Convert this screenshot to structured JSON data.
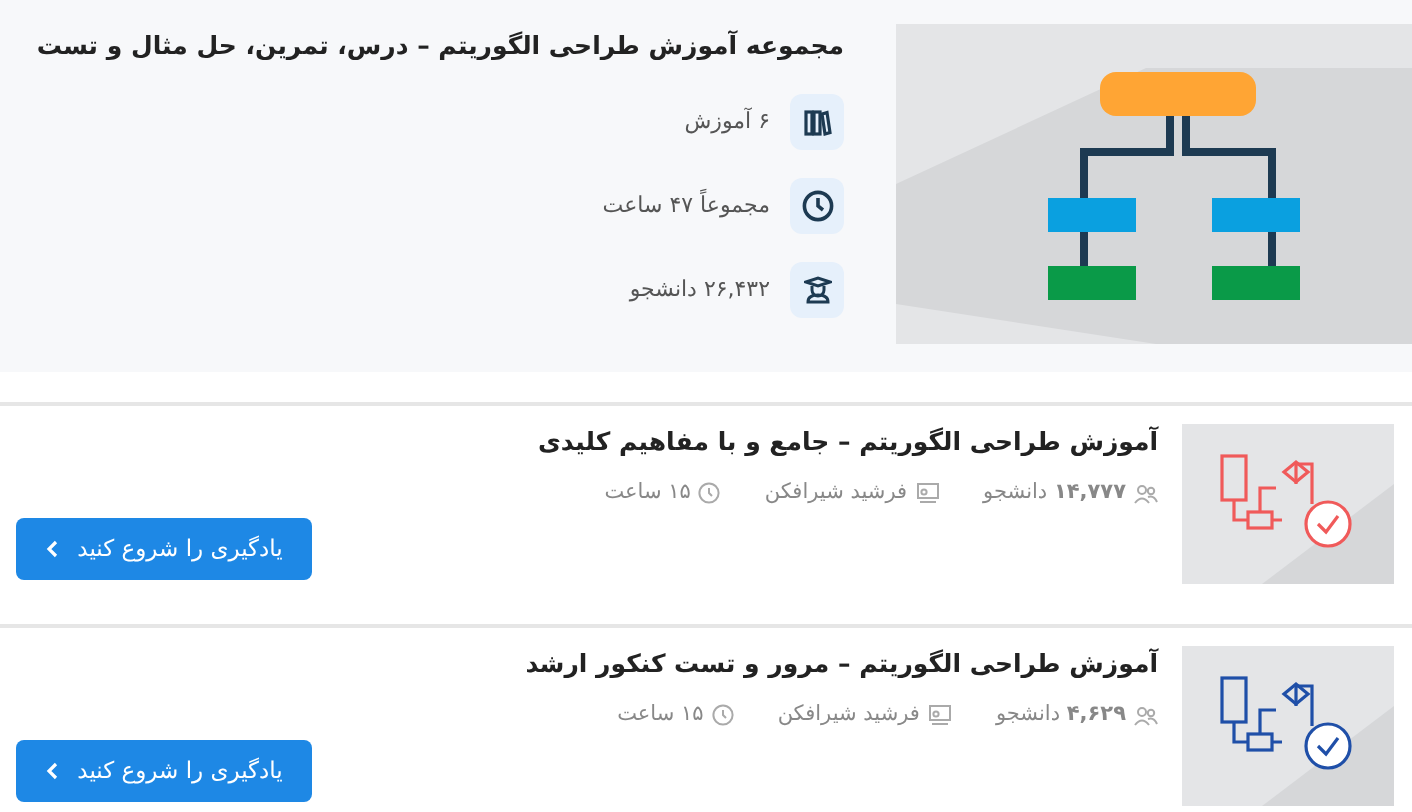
{
  "collection": {
    "title": "مجموعه آموزش طراحی الگوریتم – درس، تمرین، حل مثال و تست",
    "stats": [
      {
        "kind": "books",
        "text": "۶ آموزش"
      },
      {
        "kind": "clock",
        "text": "مجموعاً ۴۷ ساعت"
      },
      {
        "kind": "graduate",
        "text": "۲۶,۴۳۲ دانشجو"
      }
    ]
  },
  "courses": [
    {
      "title": "آموزش طراحی الگوریتم – جامع و با مفاهیم کلیدی",
      "students": "**۱۴,۷۷۷** دانشجو",
      "instructor": "فرشید شیرافکن",
      "duration": "۱۵ ساعت",
      "color": "#f05a5a",
      "button": "یادگیری را شروع کنید"
    },
    {
      "title": "آموزش طراحی الگوریتم – مرور و تست کنکور ارشد",
      "students": "**۴,۶۲۹** دانشجو",
      "instructor": "فرشید شیرافکن",
      "duration": "۱۵ ساعت",
      "color": "#1f4fa8",
      "button": "یادگیری را شروع کنید"
    }
  ]
}
